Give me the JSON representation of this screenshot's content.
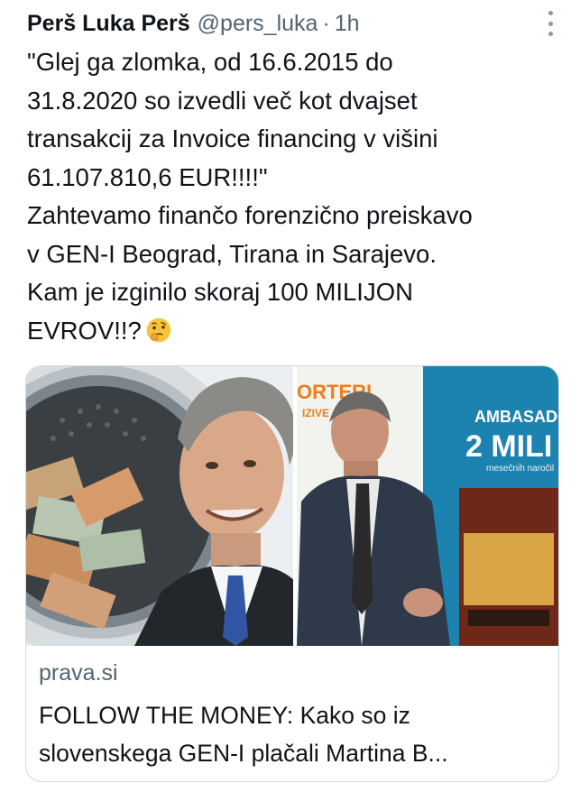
{
  "tweet": {
    "display_name": "Perš Luka Perš",
    "handle": "@pers_luka",
    "separator": "·",
    "time": "1h",
    "more_icon": "more-vertical-icon",
    "text_lines": [
      "\"Glej ga zlomka, od 16.6.2015 do",
      "31.8.2020 so izvedli več kot dvajset",
      "transakcij za Invoice financing v višini",
      "61.107.810,6 EUR!!!!\"",
      "Zahtevamo finančo forenzično preiskavo",
      "v GEN-I Beograd, Tirana in Sarajevo.",
      "Kam je izginilo skoraj 100 MILIJON",
      "EVROV!!?"
    ],
    "emoji": "thinking-face-emoji"
  },
  "card": {
    "domain": "prava.si",
    "title_lines": [
      "FOLLOW THE MONEY: Kako so iz",
      "slovenskega GEN-I plačali Martina B..."
    ],
    "image": {
      "left_photo": "washing-machine-money-and-smiling-man",
      "right_photo": "seated-man-with-magazine-background",
      "magazine_top_text": "ORTERI",
      "magazine_sub_text": "IZIVE",
      "magazine_right_text_1": "AMBASADO",
      "magazine_right_text_2": "2 MILI",
      "magazine_small_text": "mesečnih naročil"
    }
  },
  "colors": {
    "text": "#0f1419",
    "secondary": "#536471",
    "border": "#cfd9de",
    "magazine_blue": "#1c83b0"
  }
}
